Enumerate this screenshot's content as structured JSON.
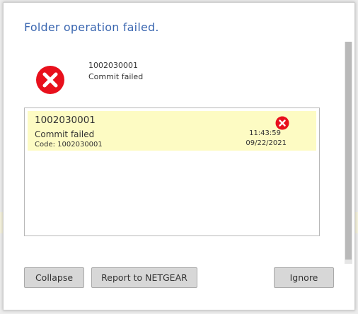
{
  "dialog": {
    "title": "Folder operation failed."
  },
  "summary": {
    "code": "1002030001",
    "message": "Commit failed",
    "icon": "error-icon"
  },
  "details": {
    "rows": [
      {
        "code": "1002030001",
        "message": "Commit failed",
        "subcode": "Code: 1002030001",
        "time": "11:43:59",
        "date": "09/22/2021",
        "icon": "error-icon"
      }
    ]
  },
  "buttons": {
    "collapse": "Collapse",
    "report": "Report to NETGEAR",
    "ignore": "Ignore"
  },
  "colors": {
    "title": "#3a66b0",
    "error": "#e8101c",
    "row_highlight": "#fdfbc3",
    "button_bg": "#d7d7d7"
  }
}
